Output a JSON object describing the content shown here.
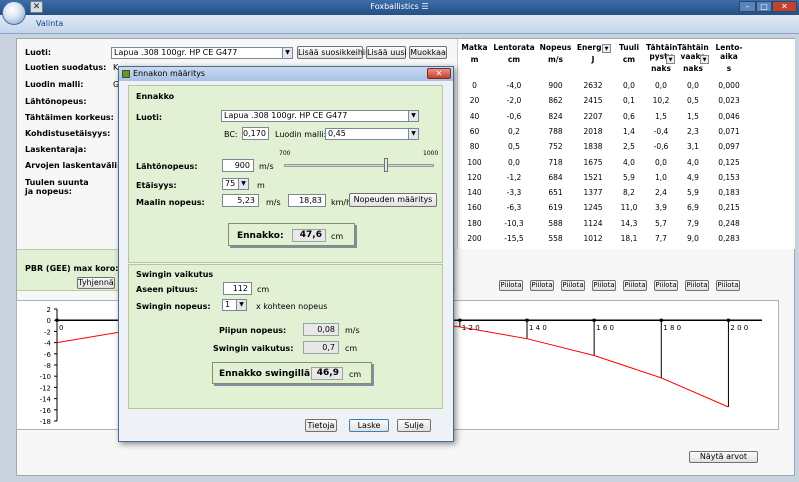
{
  "app": {
    "title": "Foxballistics",
    "title_suffix": "☰",
    "ribbon_tab": "Valinta",
    "qat_icon": "close-x-icon",
    "min": "–",
    "max": "□",
    "close": "✕"
  },
  "form": {
    "luoti_label": "Luoti:",
    "luoti_value": "Lapua .308 100gr. HP CE G477",
    "add_fav": "Lisää suosikkeihin",
    "add_new": "Lisää uusi",
    "edit": "Muokkaa",
    "suodatus_label": "Luotien suodatus:",
    "suodatus_value": "K",
    "malli_label": "Luodin malli:",
    "malli_value": "G",
    "lahto_label": "Lähtönopeus:",
    "korkeus_label": "Tähtäimen korkeus:",
    "kohdistus_label": "Kohdistusetäisyys:",
    "laskenta_label": "Laskentaraja:",
    "arvojen_label": "Arvojen laskentaväli:",
    "tuuli_label1": "Tuulen suunta",
    "tuuli_label2": "ja nopeus:",
    "pbr_label": "PBR (GEE) max koro:",
    "clear": "Tyhjennä"
  },
  "table": {
    "headers": [
      {
        "t": "Matka",
        "u": "m"
      },
      {
        "t": "Lentorata",
        "u": "cm"
      },
      {
        "t": "Nopeus",
        "u": "m/s"
      },
      {
        "t": "Energia",
        "u": "J"
      },
      {
        "t": "Tuuli",
        "u": "cm"
      },
      {
        "t": "Tähtäin pysty",
        "u": "naks"
      },
      {
        "t": "Tähtäin vaaka",
        "u": "naks"
      },
      {
        "t": "Lento-aika",
        "u": "s"
      }
    ],
    "rows": [
      [
        "0",
        "-4,0",
        "900",
        "2632",
        "0,0",
        "0,0",
        "0,0",
        "0,000"
      ],
      [
        "20",
        "-2,0",
        "862",
        "2415",
        "0,1",
        "10,2",
        "0,5",
        "0,023"
      ],
      [
        "40",
        "-0,6",
        "824",
        "2207",
        "0,6",
        "1,5",
        "1,5",
        "0,046"
      ],
      [
        "60",
        "0,2",
        "788",
        "2018",
        "1,4",
        "-0,4",
        "2,3",
        "0,071"
      ],
      [
        "80",
        "0,5",
        "752",
        "1838",
        "2,5",
        "-0,6",
        "3,1",
        "0,097"
      ],
      [
        "100",
        "0,0",
        "718",
        "1675",
        "4,0",
        "0,0",
        "4,0",
        "0,125"
      ],
      [
        "120",
        "-1,2",
        "684",
        "1521",
        "5,9",
        "1,0",
        "4,9",
        "0,153"
      ],
      [
        "140",
        "-3,3",
        "651",
        "1377",
        "8,2",
        "2,4",
        "5,9",
        "0,183"
      ],
      [
        "160",
        "-6,3",
        "619",
        "1245",
        "11,0",
        "3,9",
        "6,9",
        "0,215"
      ],
      [
        "180",
        "-10,3",
        "588",
        "1124",
        "14,3",
        "5,7",
        "7,9",
        "0,248"
      ],
      [
        "200",
        "-15,5",
        "558",
        "1012",
        "18,1",
        "7,7",
        "9,0",
        "0,283"
      ]
    ],
    "hide_button": "Piilota",
    "show_values": "Näytä arvot"
  },
  "chart_data": {
    "type": "line",
    "y_ticks": [
      "2",
      "0",
      "-2",
      "-4",
      "-6",
      "-8",
      "-10",
      "-12",
      "-14",
      "-16",
      "-18"
    ],
    "ylim": [
      -18,
      2
    ],
    "x_labels": [
      "0",
      "1 2 0",
      "1 4 0",
      "1 6 0",
      "1 8 0",
      "2 0 0"
    ],
    "x": [
      0,
      20,
      40,
      60,
      80,
      100,
      120,
      140,
      160,
      180,
      200
    ],
    "series": [
      {
        "values": [
          -4.0,
          -2.0,
          -0.6,
          0.2,
          0.5,
          0.0,
          -1.2,
          -3.3,
          -6.3,
          -10.3,
          -15.5
        ]
      }
    ],
    "color": "#ff0000"
  },
  "dialog": {
    "title": "Ennakon määritys",
    "close": "✕",
    "group1": "Ennakko",
    "luoti_label": "Luoti:",
    "luoti_value": "Lapua .308 100gr. HP CE G477",
    "bc_label": "BC:",
    "bc_value": "0,170",
    "malli_label": "Luodin malli:",
    "malli_value": "0,45",
    "lahto_label": "Lähtönopeus:",
    "lahto_value": "900",
    "lahto_unit": "m/s",
    "slider_min": "700",
    "slider_max": "1000",
    "slider_level": 0.68,
    "etaisyys_label": "Etäisyys:",
    "etaisyys_value": "75",
    "etaisyys_unit": "m",
    "maali_label": "Maalin nopeus:",
    "maali_value": "5,23",
    "maali_unit": "m/s",
    "maali_kmh": "18,83",
    "kmh_unit": "km/h",
    "nopeus_btn": "Nopeuden määritys",
    "ennakko_label": "Ennakko:",
    "ennakko_value": "47,6",
    "ennakko_unit": "cm",
    "group2": "Swingin vaikutus",
    "aseen_label": "Aseen pituus:",
    "aseen_value": "112",
    "aseen_unit": "cm",
    "swing_label": "Swingin nopeus:",
    "swing_value": "1",
    "swing_unit": "x kohteen nopeus",
    "piipun_label": "Piipun nopeus:",
    "piipun_value": "0,08",
    "piipun_unit": "m/s",
    "svaik_label": "Swingin vaikutus:",
    "svaik_value": "0,7",
    "svaik_unit": "cm",
    "swingilla_label": "Ennakko swingillä:",
    "swingilla_value": "46,9",
    "swingilla_unit": "cm",
    "btn_tietoja": "Tietoja",
    "btn_laske": "Laske",
    "btn_sulje": "Sulje"
  }
}
